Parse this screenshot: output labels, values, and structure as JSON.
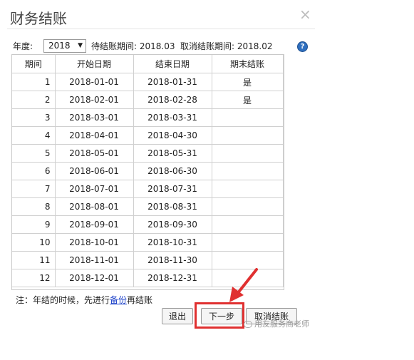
{
  "dialog": {
    "title": "财务结账",
    "close_glyph": "×"
  },
  "toolbar": {
    "year_label": "年度:",
    "year_value": "2018",
    "pending_label": "待结账期间: 2018.03",
    "cancel_period_label": "取消结账期间: 2018.02",
    "help_glyph": "?"
  },
  "table": {
    "headers": [
      "期间",
      "开始日期",
      "结束日期",
      "期末结账"
    ],
    "rows": [
      {
        "period": "1",
        "start": "2018-01-01",
        "end": "2018-01-31",
        "closed": "是"
      },
      {
        "period": "2",
        "start": "2018-02-01",
        "end": "2018-02-28",
        "closed": "是"
      },
      {
        "period": "3",
        "start": "2018-03-01",
        "end": "2018-03-31",
        "closed": ""
      },
      {
        "period": "4",
        "start": "2018-04-01",
        "end": "2018-04-30",
        "closed": ""
      },
      {
        "period": "5",
        "start": "2018-05-01",
        "end": "2018-05-31",
        "closed": ""
      },
      {
        "period": "6",
        "start": "2018-06-01",
        "end": "2018-06-30",
        "closed": ""
      },
      {
        "period": "7",
        "start": "2018-07-01",
        "end": "2018-07-31",
        "closed": ""
      },
      {
        "period": "8",
        "start": "2018-08-01",
        "end": "2018-08-31",
        "closed": ""
      },
      {
        "period": "9",
        "start": "2018-09-01",
        "end": "2018-09-30",
        "closed": ""
      },
      {
        "period": "10",
        "start": "2018-10-01",
        "end": "2018-10-31",
        "closed": ""
      },
      {
        "period": "11",
        "start": "2018-11-01",
        "end": "2018-11-30",
        "closed": ""
      },
      {
        "period": "12",
        "start": "2018-12-01",
        "end": "2018-12-31",
        "closed": ""
      }
    ]
  },
  "note": {
    "prefix": "注：年结的时候，先进行",
    "link": "备份",
    "suffix": "再结账"
  },
  "buttons": {
    "exit": "退出",
    "next": "下一步",
    "cancel_close": "取消结账"
  },
  "watermark": "用友服务商老师",
  "colors": {
    "highlight": "#e03030",
    "link": "#1a3fc8",
    "help": "#2f6fbf"
  }
}
